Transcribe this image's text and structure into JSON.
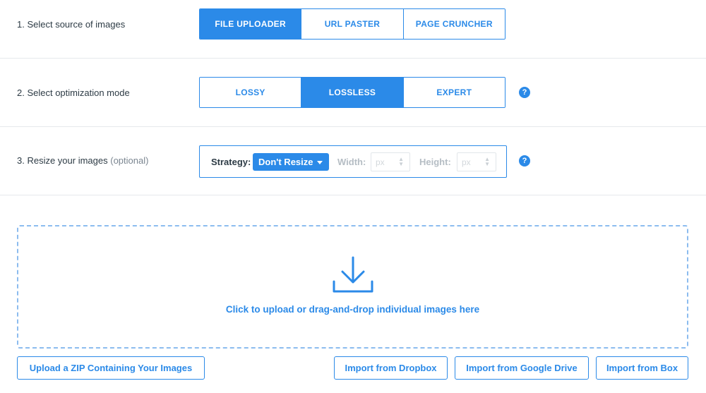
{
  "source": {
    "label": "1. Select source of images",
    "options": [
      "FILE UPLOADER",
      "URL PASTER",
      "PAGE CRUNCHER"
    ],
    "selected": "FILE UPLOADER"
  },
  "mode": {
    "label": "2. Select optimization mode",
    "options": [
      "LOSSY",
      "LOSSLESS",
      "EXPERT"
    ],
    "selected": "LOSSLESS",
    "help_icon": "?"
  },
  "resize": {
    "label": "3. Resize your images",
    "optional": "(optional)",
    "strategy_label": "Strategy:",
    "strategy_value": "Don't Resize",
    "width_label": "Width:",
    "width_placeholder": "px",
    "height_label": "Height:",
    "height_placeholder": "px",
    "help_icon": "?"
  },
  "dropzone": {
    "text": "Click to upload or drag-and-drop individual images here",
    "icon": "download-tray-icon"
  },
  "buttons": {
    "zip": "Upload a ZIP Containing Your Images",
    "dropbox": "Import from Dropbox",
    "gdrive": "Import from Google Drive",
    "box": "Import from Box"
  },
  "colors": {
    "accent": "#2b8ae8",
    "text": "#2d3b45",
    "muted": "#b5bdc4"
  }
}
